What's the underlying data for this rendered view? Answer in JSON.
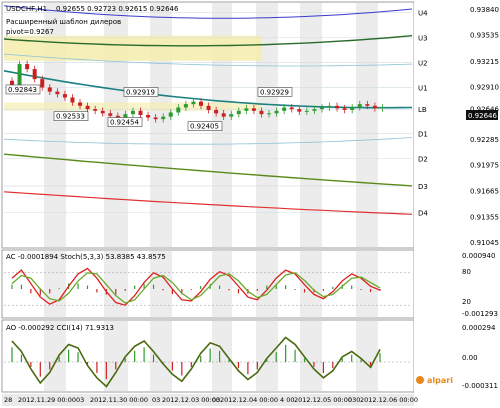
{
  "chart_data": [
    {
      "type": "line",
      "panel": "main",
      "header": {
        "symbol": "USDCHF,H1",
        "ohlc": "0.92655 0.92723 0.92615 0.92646",
        "subtitle": "Расширенный шаблон дилеров",
        "pivot_label": "pivot=0.9267"
      },
      "ylim": [
        0.91,
        0.939
      ],
      "y_ticks": [
        "0.93840",
        "0.93535",
        "0.93215",
        "0.92910",
        "0.92646",
        "0.92285",
        "0.91975",
        "0.91665",
        "0.91355",
        "0.91045"
      ],
      "current_price": "0.92646",
      "close_series": [
        0.929,
        0.9318,
        0.9312,
        0.93,
        0.929,
        0.9285,
        0.9282,
        0.9278,
        0.9272,
        0.9268,
        0.9264,
        0.9262,
        0.9259,
        0.9256,
        0.9253,
        0.9258,
        0.9262,
        0.9257,
        0.9254,
        0.9252,
        0.9255,
        0.926,
        0.9266,
        0.927,
        0.9273,
        0.9268,
        0.9263,
        0.9259,
        0.9255,
        0.9258,
        0.9262,
        0.9265,
        0.9262,
        0.9258,
        0.9259,
        0.9262,
        0.9266,
        0.9264,
        0.9261,
        0.9262,
        0.9264,
        0.9266,
        0.9268,
        0.9265,
        0.9263,
        0.9266,
        0.927,
        0.9268,
        0.9265,
        0.9266
      ],
      "pivot_levels": [
        {
          "name": "U4",
          "value": 0.938
        },
        {
          "name": "U3",
          "value": 0.935
        },
        {
          "name": "U2",
          "value": 0.932
        },
        {
          "name": "U1",
          "value": 0.929
        },
        {
          "name": "LB",
          "value": 0.9264
        },
        {
          "name": "D1",
          "value": 0.9235
        },
        {
          "name": "D2",
          "value": 0.9205
        },
        {
          "name": "D3",
          "value": 0.9172
        },
        {
          "name": "D4",
          "value": 0.914
        }
      ],
      "price_labels": [
        {
          "text": "0.92843",
          "value": 0.9287
        },
        {
          "text": "0.92919",
          "value": 0.9284
        },
        {
          "text": "0.92533",
          "value": 0.9255
        },
        {
          "text": "0.92454",
          "value": 0.9248
        },
        {
          "text": "0.92405",
          "value": 0.9243
        },
        {
          "text": "0.92929",
          "value": 0.9284
        }
      ],
      "x_ticks": [
        "28",
        "2012.11.29 00:00",
        "03",
        "2012.11.30 00:00",
        "03",
        "2012.12.03 00:00",
        "03",
        "2012.12.04 00:00",
        "4 00",
        "2012.12.05 00:00",
        "030",
        "2012.12.06 00:00"
      ],
      "colors": {
        "up": "#2e9b2e",
        "down": "#cc2020",
        "ma_teal": "#1a8080",
        "green_line": "#5a8a1a",
        "red_line": "#e03030",
        "blue_line": "#3a3acc",
        "highlight": "#f5eeb0"
      }
    },
    {
      "type": "line",
      "panel": "oscillator",
      "label": "AC -0.0001894  Stoch(5,3,3) 53.8385 43.8575",
      "ylim": [
        -0.001293,
        0.00094
      ],
      "y_ticks": [
        "0.000940",
        "80",
        "20",
        "-0.001293"
      ],
      "series": [
        {
          "name": "%K",
          "values": [
            70,
            85,
            60,
            35,
            22,
            30,
            55,
            78,
            88,
            70,
            45,
            25,
            20,
            38,
            62,
            80,
            72,
            50,
            30,
            28,
            45,
            68,
            82,
            75,
            55,
            35,
            30,
            48,
            70,
            85,
            78,
            58,
            40,
            32,
            45,
            65,
            78,
            70,
            55,
            48
          ]
        },
        {
          "name": "%D",
          "values": [
            60,
            75,
            70,
            50,
            32,
            28,
            42,
            65,
            80,
            78,
            58,
            38,
            24,
            30,
            50,
            70,
            75,
            62,
            42,
            30,
            38,
            56,
            74,
            78,
            65,
            46,
            34,
            40,
            58,
            76,
            80,
            66,
            48,
            36,
            40,
            55,
            70,
            72,
            62,
            52
          ]
        }
      ]
    },
    {
      "type": "bar",
      "panel": "lower",
      "label": "AO -0.000292  CCI(14) 71.9313",
      "ylim": [
        -0.000311,
        0.000294
      ],
      "y_ticks": [
        "0.000294",
        "0.00",
        "-0.000311"
      ],
      "series": [
        {
          "name": "CCI",
          "values": [
            120,
            60,
            -40,
            -120,
            -60,
            40,
            100,
            80,
            -20,
            -90,
            -140,
            -60,
            30,
            90,
            120,
            60,
            -10,
            -70,
            -110,
            -40,
            50,
            110,
            90,
            20,
            -50,
            -100,
            -60,
            20,
            80,
            140,
            100,
            30,
            -40,
            -90,
            -50,
            30,
            60,
            20,
            -30,
            72
          ]
        }
      ]
    }
  ],
  "branding": {
    "logo_text": "alpari"
  },
  "scale_markers": [
    "0.09",
    "0.18",
    "0.22"
  ]
}
